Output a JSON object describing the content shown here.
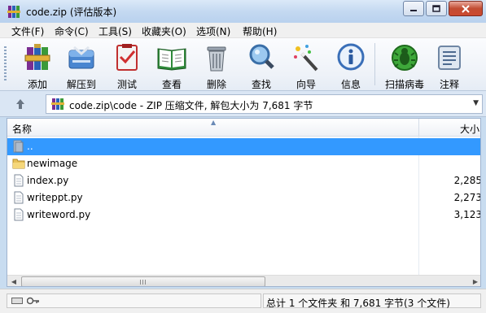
{
  "window": {
    "title": "code.zip (评估版本)"
  },
  "menu": {
    "items": [
      {
        "label": "文件(F)"
      },
      {
        "label": "命令(C)"
      },
      {
        "label": "工具(S)"
      },
      {
        "label": "收藏夹(O)"
      },
      {
        "label": "选项(N)"
      },
      {
        "label": "帮助(H)"
      }
    ]
  },
  "toolbar": {
    "items": [
      {
        "label": "添加",
        "icon": "add-archive-icon"
      },
      {
        "label": "解压到",
        "icon": "extract-to-icon"
      },
      {
        "label": "测试",
        "icon": "test-icon"
      },
      {
        "label": "查看",
        "icon": "view-book-icon"
      },
      {
        "label": "删除",
        "icon": "trash-icon"
      },
      {
        "label": "查找",
        "icon": "magnifier-icon"
      },
      {
        "label": "向导",
        "icon": "wizard-wand-icon"
      },
      {
        "label": "信息",
        "icon": "info-icon"
      },
      {
        "label": "扫描病毒",
        "icon": "virus-scan-icon"
      },
      {
        "label": "注释",
        "icon": "comment-icon"
      }
    ]
  },
  "address": {
    "path": "code.zip\\code - ZIP 压缩文件, 解包大小为 7,681 字节"
  },
  "list": {
    "columns": {
      "name": "名称",
      "size": "大小"
    },
    "rows": [
      {
        "name": "..",
        "size": "",
        "type": "parent-folder",
        "selected": true
      },
      {
        "name": "newimage",
        "size": "",
        "type": "folder",
        "selected": false
      },
      {
        "name": "index.py",
        "size": "2,285",
        "type": "file",
        "selected": false
      },
      {
        "name": "writeppt.py",
        "size": "2,273",
        "type": "file",
        "selected": false
      },
      {
        "name": "writeword.py",
        "size": "3,123",
        "type": "file",
        "selected": false
      }
    ]
  },
  "status": {
    "text": "总计 1 个文件夹 和 7,681 字节(3 个文件)"
  },
  "colors": {
    "selection": "#3399ff",
    "titlebar": "#c4d9f1"
  }
}
